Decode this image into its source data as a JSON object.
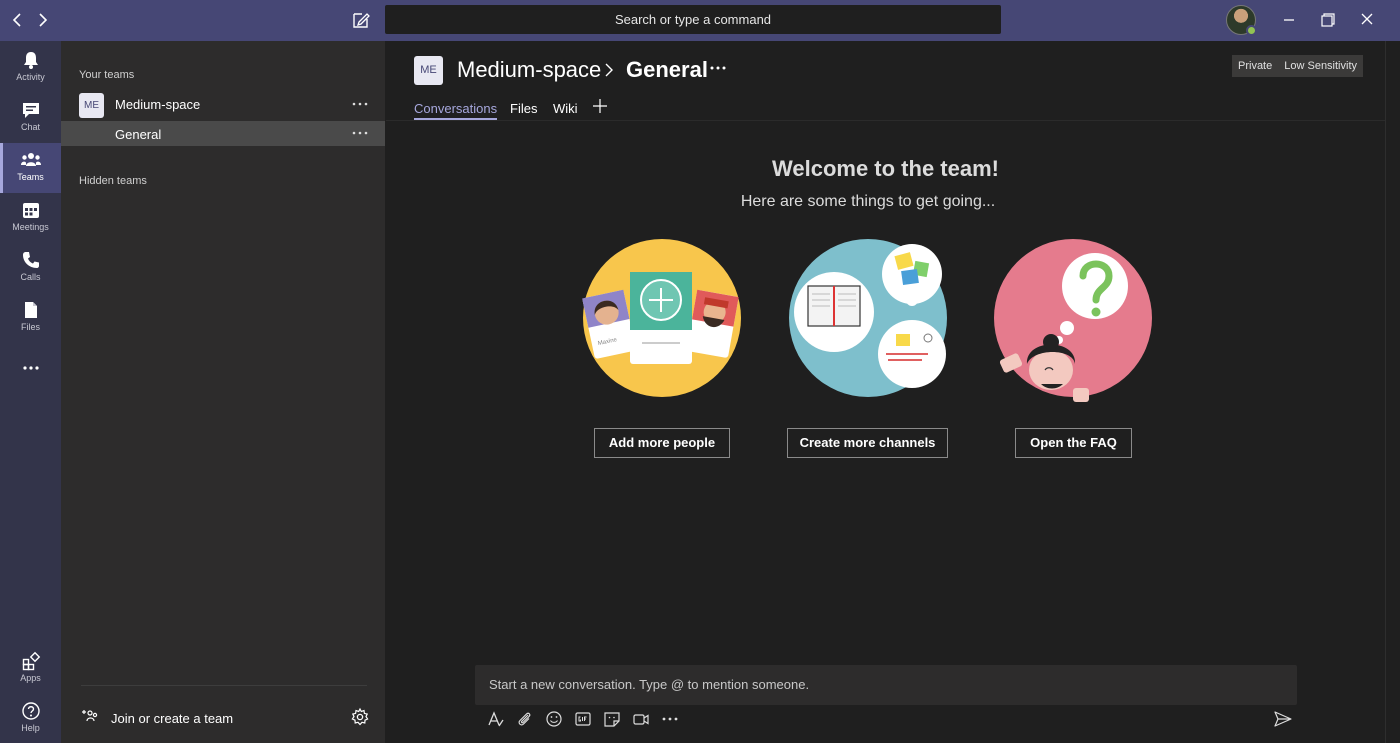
{
  "titlebar": {
    "search_placeholder": "Search or type a command"
  },
  "rail": {
    "items": [
      {
        "label": "Activity",
        "icon": "bell-icon"
      },
      {
        "label": "Chat",
        "icon": "chat-icon"
      },
      {
        "label": "Teams",
        "icon": "teams-icon"
      },
      {
        "label": "Meetings",
        "icon": "calendar-icon"
      },
      {
        "label": "Calls",
        "icon": "phone-icon"
      },
      {
        "label": "Files",
        "icon": "file-icon"
      }
    ],
    "bottom": [
      {
        "label": "Apps",
        "icon": "apps-icon"
      },
      {
        "label": "Help",
        "icon": "help-icon"
      }
    ]
  },
  "teams_panel": {
    "your_teams_label": "Your teams",
    "team": {
      "badge": "ME",
      "name": "Medium-space"
    },
    "channel": {
      "name": "General"
    },
    "hidden_teams_label": "Hidden teams",
    "join_label": "Join or create a team"
  },
  "channel_header": {
    "badge": "ME",
    "team_name": "Medium-space",
    "channel_name": "General",
    "pills": [
      "Private",
      "Low Sensitivity"
    ],
    "tabs": [
      "Conversations",
      "Files",
      "Wiki"
    ]
  },
  "welcome": {
    "title": "Welcome to the team!",
    "subtitle": "Here are some things to get going...",
    "actions": [
      "Add more people",
      "Create more channels",
      "Open the FAQ"
    ],
    "card_names": [
      "Maxine"
    ]
  },
  "composer": {
    "placeholder": "Start a new conversation. Type @ to mention someone."
  },
  "colors": {
    "titlebar": "#464775",
    "rail": "#33344a",
    "accent": "#a6a7dc",
    "main_bg": "#1f1f1f"
  }
}
